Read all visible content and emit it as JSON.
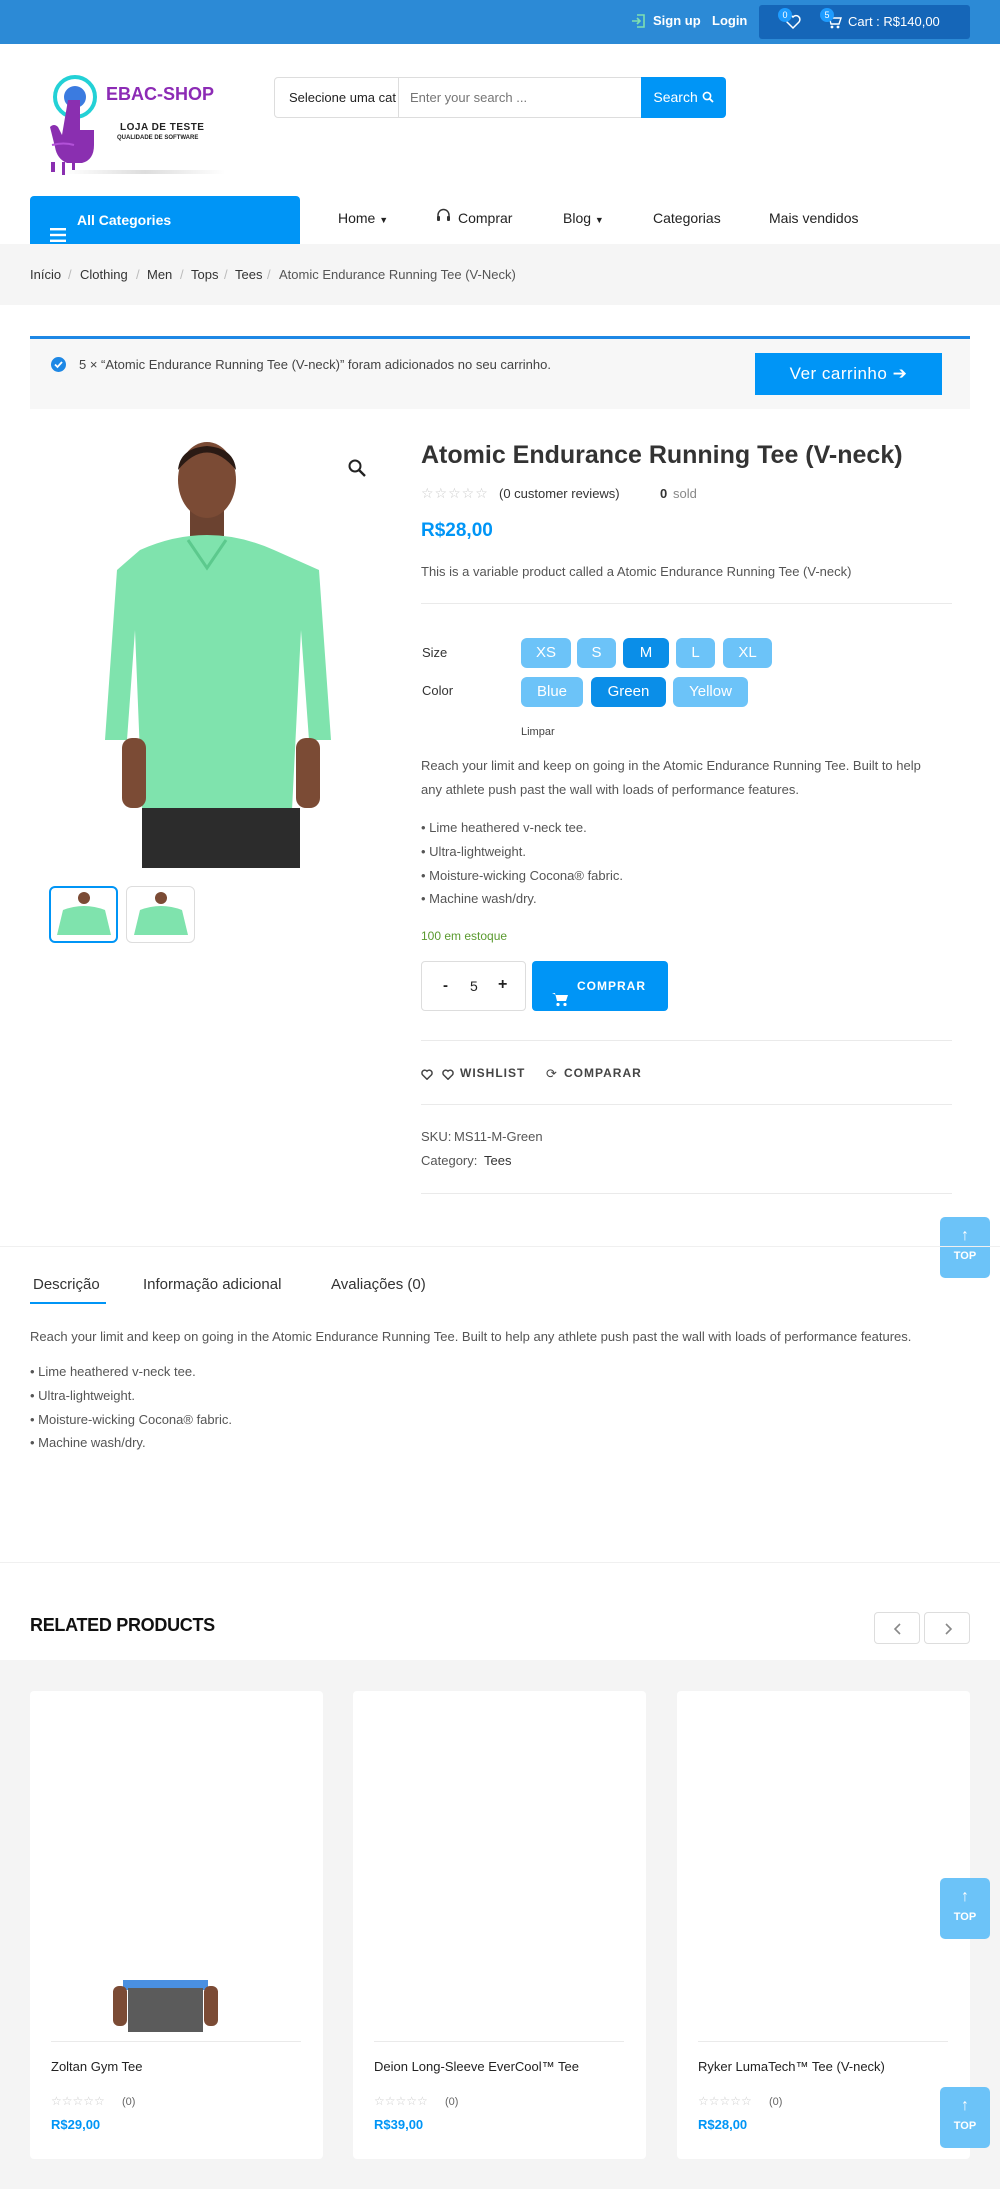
{
  "topbar": {
    "signup": "Sign up",
    "login": "Login",
    "wishlist_count": "0",
    "cart_count": "5",
    "cart_label": "Cart : R$140,00"
  },
  "header": {
    "logo_title": "EBAC-SHOP",
    "logo_subtitle": "LOJA DE TESTE",
    "logo_tagline": "QUALIDADE DE SOFTWARE",
    "search_category": "Selecione uma cat",
    "search_placeholder": "Enter your search ...",
    "search_button": "Search"
  },
  "nav": {
    "all_categories": "All Categories",
    "items": [
      "Home",
      "Comprar",
      "Blog",
      "Categorias",
      "Mais vendidos"
    ]
  },
  "breadcrumb": [
    "Início",
    "Clothing",
    "Men",
    "Tops",
    "Tees",
    "Atomic Endurance Running Tee (V-Neck)"
  ],
  "notice": {
    "text": "5 × “Atomic Endurance Running Tee (V-neck)” foram adicionados no seu carrinho.",
    "button": "Ver carrinho"
  },
  "product": {
    "title": "Atomic Endurance Running Tee (V-neck)",
    "reviews": "(0 customer reviews)",
    "sold_count": "0",
    "sold_label": "sold",
    "price": "R$28,00",
    "short_description": "This is a variable product called a Atomic Endurance Running Tee (V-neck)",
    "size_label": "Size",
    "sizes": [
      "XS",
      "S",
      "M",
      "L",
      "XL"
    ],
    "selected_size": "M",
    "color_label": "Color",
    "colors": [
      "Blue",
      "Green",
      "Yellow"
    ],
    "selected_color": "Green",
    "clear": "Limpar",
    "description_line1": "Reach your limit and keep on going in the Atomic Endurance Running Tee. Built to help",
    "description_line2": "any athlete push past the wall with loads of performance features.",
    "features": [
      "• Lime heathered v-neck tee.",
      "• Ultra-lightweight.",
      "• Moisture-wicking Cocona® fabric.",
      "• Machine wash/dry."
    ],
    "stock": "100 em estoque",
    "quantity": "5",
    "buy_button": "COMPRAR",
    "wishlist": "WISHLIST",
    "compare": "COMPARAR",
    "sku_label": "SKU:",
    "sku": "MS11-M-Green",
    "category_label": "Category:",
    "category": "Tees"
  },
  "top_button": "TOP",
  "tabs": {
    "items": [
      "Descrição",
      "Informação adicional",
      "Avaliações (0)"
    ],
    "active": "Descrição",
    "description": "Reach your limit and keep on going in the Atomic Endurance Running Tee. Built to help any athlete push past the wall with loads of performance features.",
    "features": [
      "• Lime heathered v-neck tee.",
      "• Ultra-lightweight.",
      "• Moisture-wicking Cocona® fabric.",
      "• Machine wash/dry."
    ]
  },
  "related": {
    "title": "RELATED PRODUCTS",
    "products": [
      {
        "name": "Zoltan Gym Tee",
        "reviews": "(0)",
        "price": "R$29,00"
      },
      {
        "name": "Deion Long-Sleeve EverCool™ Tee",
        "reviews": "(0)",
        "price": "R$39,00"
      },
      {
        "name": "Ryker LumaTech™ Tee (V-neck)",
        "reviews": "(0)",
        "price": "R$28,00"
      }
    ]
  },
  "colors": {
    "brand_blue": "#0095f6",
    "topbar": "#2c8ad6",
    "light_blue": "#6cc3f8",
    "stock_green": "#5a9a2f",
    "logo_purple": "#8c2bb5"
  }
}
